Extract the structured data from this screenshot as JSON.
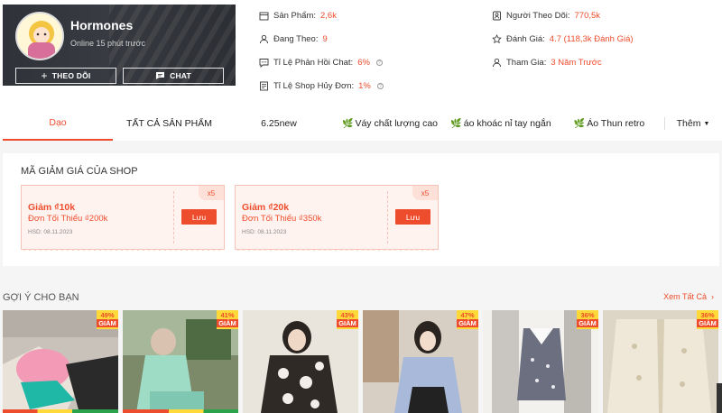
{
  "shop": {
    "name": "Hormones",
    "online_status": "Online 15 phút trước",
    "follow_label": "THEO DÕI",
    "chat_label": "CHAT"
  },
  "stats": {
    "products_label": "Sản Phẩm:",
    "products_value": "2,6k",
    "following_label": "Đang Theo:",
    "following_value": "9",
    "chat_response_label": "Tỉ Lệ Phản Hồi Chat:",
    "chat_response_value": "6%",
    "cancel_rate_label": "Tỉ Lệ Shop Hủy Đơn:",
    "cancel_rate_value": "1%",
    "followers_label": "Người Theo Dõi:",
    "followers_value": "770,5k",
    "rating_label": "Đánh Giá:",
    "rating_value": "4.7 (118,3k Đánh Giá)",
    "joined_label": "Tham Gia:",
    "joined_value": "3 Năm Trước"
  },
  "tabs": [
    {
      "label": "Dạo"
    },
    {
      "label": "TẤT CẢ SẢN PHẨM"
    },
    {
      "label": "6.25new"
    },
    {
      "label": "Váy chất lượng cao"
    },
    {
      "label": "áo khoác nỉ tay ngắn"
    },
    {
      "label": "Áo Thun retro"
    },
    {
      "label": "Thêm"
    }
  ],
  "vouchers": {
    "section_title": "MÃ GIẢM GIÁ CỦA SHOP",
    "items": [
      {
        "amount": "Giảm ₫10k",
        "min_order": "Đơn Tối Thiểu ₫200k",
        "expiry": "HSD: 08.11.2023",
        "qty": "x5",
        "save_label": "Lưu"
      },
      {
        "amount": "Giảm ₫20k",
        "min_order": "Đơn Tối Thiểu ₫350k",
        "expiry": "HSD: 08.11.2023",
        "qty": "x5",
        "save_label": "Lưu"
      }
    ]
  },
  "recommend": {
    "title": "GỢI Ý CHO BẠN",
    "see_all": "Xem Tất Cả",
    "discount_word": "GIẢM",
    "products": [
      {
        "discount": "49%"
      },
      {
        "discount": "41%"
      },
      {
        "discount": "43%"
      },
      {
        "discount": "47%"
      },
      {
        "discount": "36%"
      },
      {
        "discount": "36%"
      }
    ]
  },
  "colors": {
    "accent": "#ee4d2d",
    "badge_yellow": "#ffd839"
  }
}
